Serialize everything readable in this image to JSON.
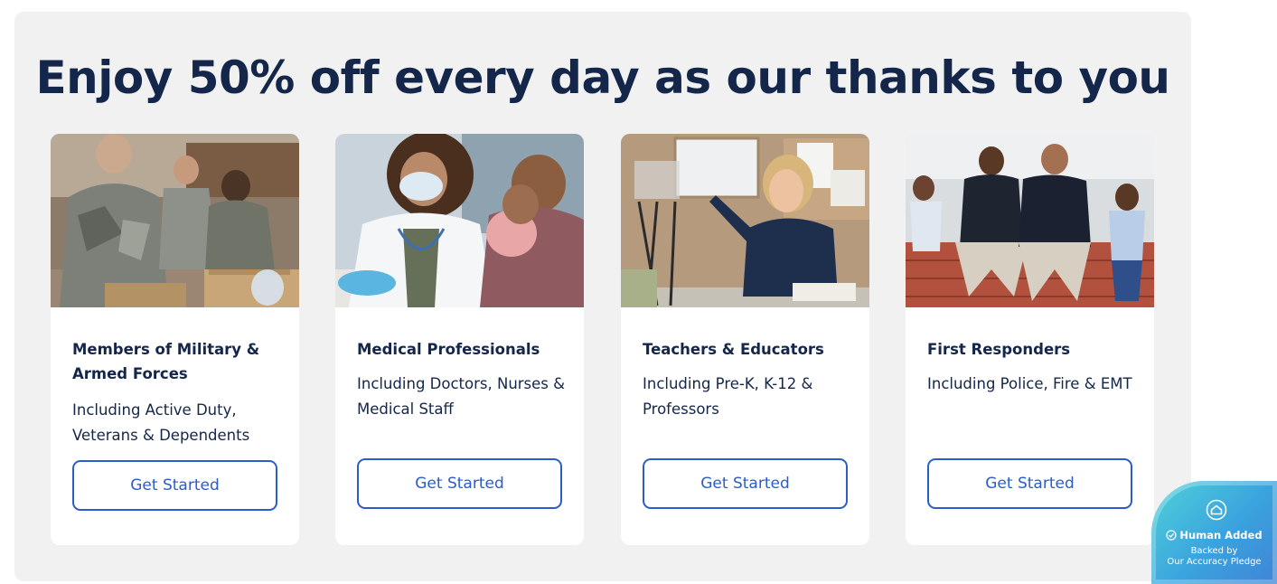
{
  "promo": {
    "heading": "Enjoy 50% off every day as our thanks to you"
  },
  "cards": [
    {
      "title": "Members of Military & Armed Forces",
      "description": "Including Active Duty, Veterans & Dependents",
      "button_label": "Get Started"
    },
    {
      "title": "Medical Professionals",
      "description": "Including Doctors, Nurses & Medical Staff",
      "button_label": "Get Started"
    },
    {
      "title": "Teachers & Educators",
      "description": "Including Pre-K, K-12 & Professors",
      "button_label": "Get Started"
    },
    {
      "title": "First Responders",
      "description": "Including Police, Fire & EMT",
      "button_label": "Get Started"
    }
  ],
  "badge": {
    "status": "Human Added",
    "backed_by": "Backed by",
    "pledge": "Our Accuracy Pledge",
    "icon": "shield-house-icon",
    "check_icon": "check-circle-icon"
  },
  "colors": {
    "heading": "#14264a",
    "accent": "#2b5cc9",
    "panel": "#f1f1f2",
    "badge_from": "#4fd2d9",
    "badge_to": "#3f84d6"
  }
}
